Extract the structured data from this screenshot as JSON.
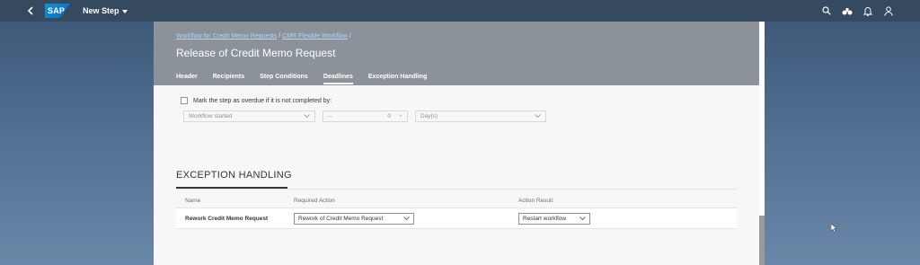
{
  "shell": {
    "title": "New Step",
    "logo_text": "SAP"
  },
  "header": {
    "breadcrumb": [
      "Workflow for Credit Memo Requests",
      "CMR Flexible Workflow"
    ],
    "title": "Release of Credit Memo Request",
    "tabs": [
      {
        "label": "Header",
        "active": false
      },
      {
        "label": "Recipients",
        "active": false
      },
      {
        "label": "Step Conditions",
        "active": false
      },
      {
        "label": "Deadlines",
        "active": true
      },
      {
        "label": "Exception Handling",
        "active": false
      }
    ]
  },
  "deadlines": {
    "overdue_label": "Mark the step as overdue if it is not completed by:",
    "event": "Workflow started",
    "stepper_value": "0",
    "stepper_minus": "—",
    "stepper_plus": "+",
    "unit": "Day(s)"
  },
  "exception": {
    "section_title": "EXCEPTION HANDLING",
    "columns": [
      "Name",
      "Required Action",
      "Action Result"
    ],
    "rows": [
      {
        "name": "Rework Credit Memo Request",
        "required_action": "Rework of Credit Memo Request",
        "action_result": "Restart workflow"
      }
    ]
  },
  "colors": {
    "shell": "#354a5f",
    "header": "#8c9299",
    "accent": "#0a6ed1"
  }
}
